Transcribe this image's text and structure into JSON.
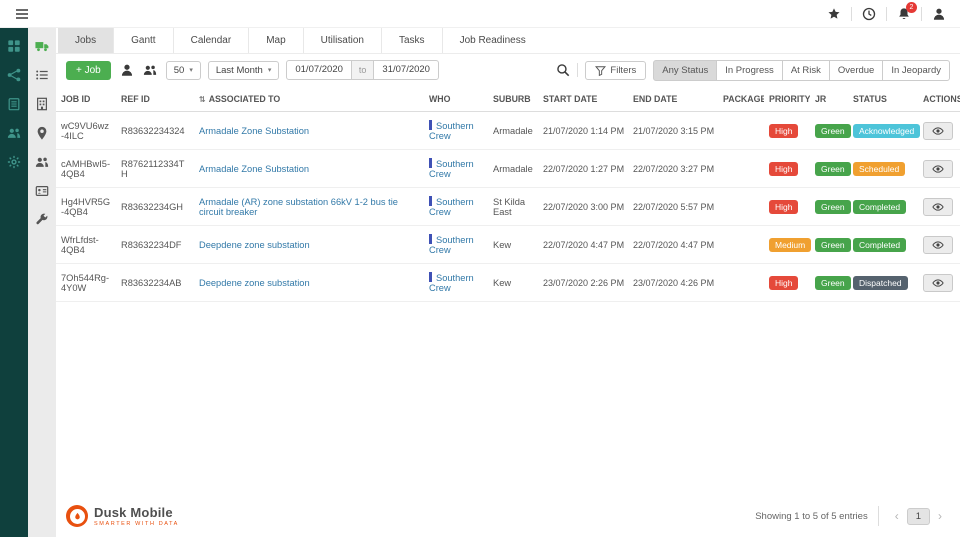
{
  "topbar": {
    "menu_icon": "hamburger-menu-icon",
    "icons": [
      "star-icon",
      "clock-icon",
      "bell-icon",
      "user-icon"
    ],
    "notification_count": "2"
  },
  "sidebar": {
    "primary": [
      "dashboard-icon",
      "share-icon",
      "clipboard-icon",
      "users-icon",
      "gear-icon"
    ],
    "secondary": [
      {
        "icon": "truck-icon",
        "active": true
      },
      {
        "icon": "list-icon"
      },
      {
        "icon": "building-icon"
      },
      {
        "icon": "pin-icon"
      },
      {
        "icon": "users-icon"
      },
      {
        "icon": "card-icon"
      },
      {
        "icon": "wrench-icon"
      }
    ]
  },
  "tabs": [
    {
      "label": "Jobs",
      "active": true
    },
    {
      "label": "Gantt"
    },
    {
      "label": "Calendar"
    },
    {
      "label": "Map"
    },
    {
      "label": "Utilisation"
    },
    {
      "label": "Tasks"
    },
    {
      "label": "Job Readiness"
    }
  ],
  "toolbar": {
    "add_job_label": "+ Job",
    "icon_buttons": [
      "user-icon",
      "users-icon"
    ],
    "page_size": "50",
    "period": "Last Month",
    "date_from": "01/07/2020",
    "to_label": "to",
    "date_to": "31/07/2020",
    "filters_label": "Filters",
    "status_filters": [
      {
        "label": "Any Status",
        "active": true
      },
      {
        "label": "In Progress"
      },
      {
        "label": "At Risk"
      },
      {
        "label": "Overdue"
      },
      {
        "label": "In Jeopardy"
      }
    ]
  },
  "table": {
    "columns": [
      {
        "label": "JOB ID"
      },
      {
        "label": "REF ID"
      },
      {
        "label": "ASSOCIATED TO",
        "sort": true
      },
      {
        "label": "WHO"
      },
      {
        "label": "SUBURB"
      },
      {
        "label": "START DATE"
      },
      {
        "label": "END DATE"
      },
      {
        "label": "PACKAGE"
      },
      {
        "label": "PRIORITY"
      },
      {
        "label": "JR"
      },
      {
        "label": "STATUS"
      },
      {
        "label": "ACTIONS"
      }
    ],
    "rows": [
      {
        "job_id": "wC9VU6wz-4ILC",
        "ref_id": "R83632234324",
        "associated_to": "Armadale Zone Substation",
        "who": "Southern Crew",
        "suburb": "Armadale",
        "start_date": "21/07/2020 1:14 PM",
        "end_date": "21/07/2020 3:15 PM",
        "package": "",
        "priority": "High",
        "jr": "Green",
        "status": "Acknowledged"
      },
      {
        "job_id": "cAMHBwI5-4QB4",
        "ref_id": "R8762112334TH",
        "associated_to": "Armadale Zone Substation",
        "who": "Southern Crew",
        "suburb": "Armadale",
        "start_date": "22/07/2020 1:27 PM",
        "end_date": "22/07/2020 3:27 PM",
        "package": "",
        "priority": "High",
        "jr": "Green",
        "status": "Scheduled"
      },
      {
        "job_id": "Hg4HVR5G-4QB4",
        "ref_id": "R83632234GH",
        "associated_to": "Armadale (AR) zone substation 66kV 1-2 bus tie circuit breaker",
        "who": "Southern Crew",
        "suburb": "St Kilda East",
        "start_date": "22/07/2020 3:00 PM",
        "end_date": "22/07/2020 5:57 PM",
        "package": "",
        "priority": "High",
        "jr": "Green",
        "status": "Completed"
      },
      {
        "job_id": "WfrLfdst-4QB4",
        "ref_id": "R83632234DF",
        "associated_to": "Deepdene zone substation",
        "who": "Southern Crew",
        "suburb": "Kew",
        "start_date": "22/07/2020 4:47 PM",
        "end_date": "22/07/2020 4:47 PM",
        "package": "",
        "priority": "Medium",
        "jr": "Green",
        "status": "Completed"
      },
      {
        "job_id": "7Oh544Rg-4Y0W",
        "ref_id": "R83632234AB",
        "associated_to": "Deepdene zone substation",
        "who": "Southern Crew",
        "suburb": "Kew",
        "start_date": "23/07/2020 2:26 PM",
        "end_date": "23/07/2020 4:26 PM",
        "package": "",
        "priority": "High",
        "jr": "Green",
        "status": "Dispatched"
      }
    ]
  },
  "colors": {
    "priority": {
      "High": "#e5493a",
      "Medium": "#f0a030"
    },
    "jr": {
      "Green": "#47a44b"
    },
    "status": {
      "Acknowledged": "#4dc4d9",
      "Scheduled": "#f0a030",
      "Completed": "#47a44b",
      "Dispatched": "#55626e"
    },
    "accent_green": "#4cae50",
    "link": "#3279a8",
    "who_bar": "#3f51b5"
  },
  "footer": {
    "brand": "Dusk Mobile",
    "tagline": "SMARTER WITH DATA",
    "showing_text": "Showing 1 to 5 of 5 entries",
    "pagination": {
      "prev": "‹",
      "current": "1",
      "next": "›"
    }
  }
}
